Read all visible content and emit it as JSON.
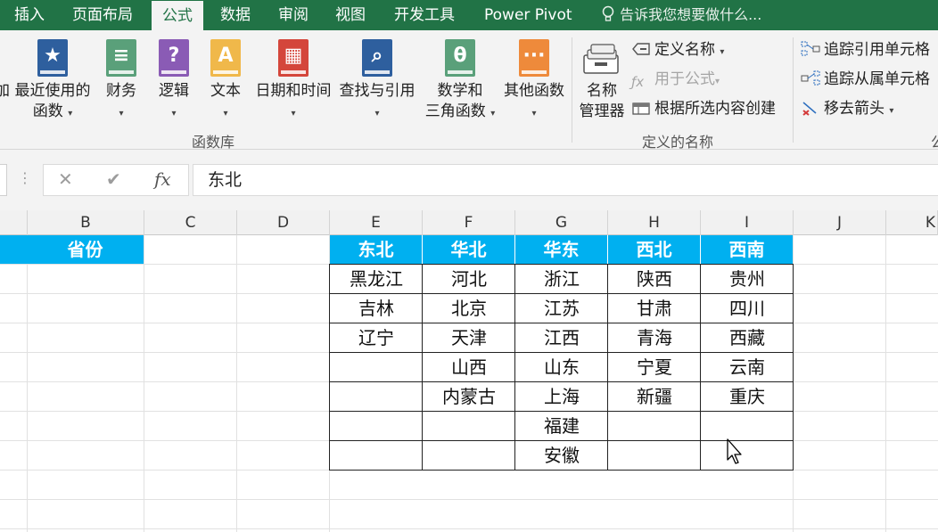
{
  "ribbon_tabs": [
    "插入",
    "页面布局",
    "公式",
    "数据",
    "审阅",
    "视图",
    "开发工具",
    "Power Pivot"
  ],
  "active_tab": "公式",
  "tell_me": "告诉我您想要做什么...",
  "function_library": {
    "partial_first": "加",
    "recent_line1": "最近使用的",
    "recent_line2": "函数",
    "finance": "财务",
    "logic": "逻辑",
    "text": "文本",
    "datetime": "日期和时间",
    "lookup": "查找与引用",
    "math_line1": "数学和",
    "math_line2": "三角函数",
    "other": "其他函数",
    "group_label": "函数库"
  },
  "defined_names": {
    "name_manager_line1": "名称",
    "name_manager_line2": "管理器",
    "define_name": "定义名称",
    "use_in_formula": "用于公式",
    "create_from_selection": "根据所选内容创建",
    "group_label": "定义的名称"
  },
  "formula_auditing": {
    "trace_precedents": "追踪引用单元格",
    "trace_dependents": "追踪从属单元格",
    "remove_arrows": "移去箭头",
    "partial_group_label": "公"
  },
  "formula_bar": {
    "cancel": "✕",
    "enter": "✔",
    "fx": "fx",
    "content": "东北"
  },
  "columns": [
    "B",
    "C",
    "D",
    "E",
    "F",
    "G",
    "H",
    "I",
    "J",
    "K"
  ],
  "left_header": "省份",
  "table": {
    "headers": [
      "东北",
      "华北",
      "华东",
      "西北",
      "西南"
    ],
    "rows": [
      [
        "黑龙江",
        "河北",
        "浙江",
        "陕西",
        "贵州"
      ],
      [
        "吉林",
        "北京",
        "江苏",
        "甘肃",
        "四川"
      ],
      [
        "辽宁",
        "天津",
        "江西",
        "青海",
        "西藏"
      ],
      [
        "",
        "山西",
        "山东",
        "宁夏",
        "云南"
      ],
      [
        "",
        "内蒙古",
        "上海",
        "新疆",
        "重庆"
      ],
      [
        "",
        "",
        "福建",
        "",
        ""
      ],
      [
        "",
        "",
        "安徽",
        "",
        ""
      ]
    ]
  },
  "colors": {
    "excel_green": "#217346",
    "header_fill": "#00b0f0"
  }
}
